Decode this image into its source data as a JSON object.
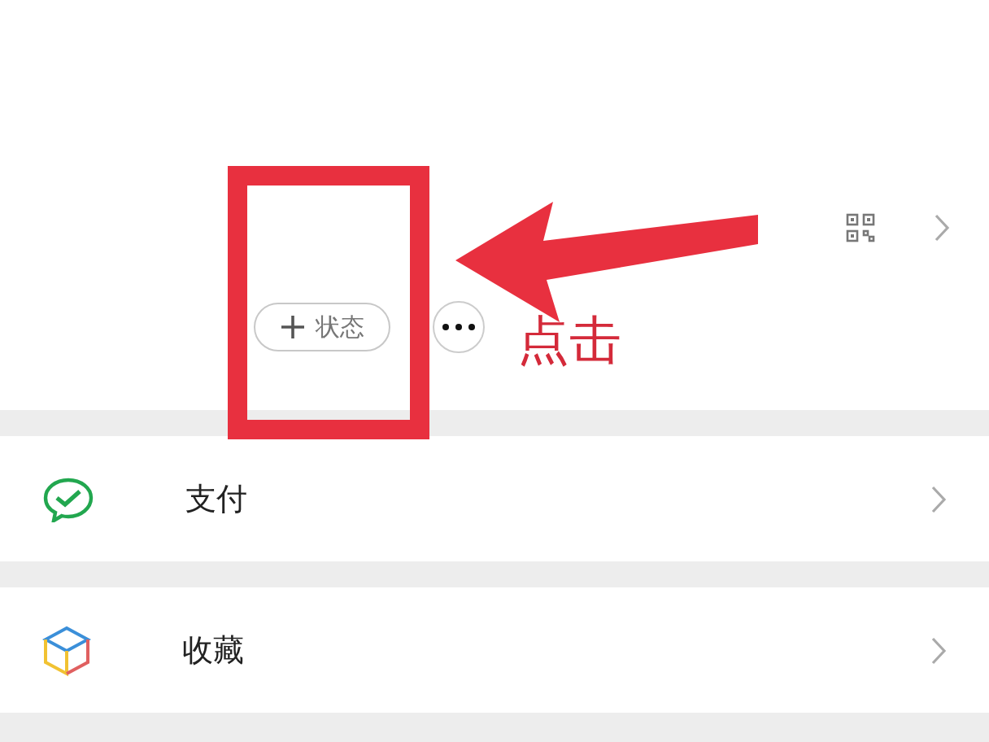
{
  "profile": {
    "status_button": {
      "label": "状态"
    }
  },
  "annotation": {
    "text": "点击"
  },
  "menu": [
    {
      "kind": "pay",
      "label": "支付"
    },
    {
      "kind": "favorites",
      "label": "收藏"
    }
  ]
}
